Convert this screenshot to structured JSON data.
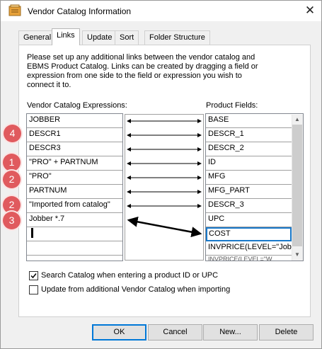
{
  "window": {
    "title": "Vendor Catalog Information",
    "close_label": "✕"
  },
  "tabs": [
    {
      "label": "General"
    },
    {
      "label": "Links"
    },
    {
      "label": "Update"
    },
    {
      "label": "Sort"
    },
    {
      "label": "Folder Structure"
    }
  ],
  "active_tab": "Links",
  "links": {
    "description": "Please set up any additional links between the vendor catalog and EBMS Product Catalog. Links can be created by dragging a field or expression from one side to the field or expression you wish to connect it to.",
    "left_header": "Vendor Catalog Expressions:",
    "right_header": "Product Fields:",
    "vendor_expressions": [
      "JOBBER",
      "DESCR1",
      "DESCR3",
      "\"PRO\" + PARTNUM",
      "\"PRO\"",
      "PARTNUM",
      "\"Imported from catalog\"",
      "Jobber *.7",
      "",
      "",
      ""
    ],
    "product_fields": [
      "BASE",
      "DESCR_1",
      "DESCR_2",
      "ID",
      "MFG",
      "MFG_PART",
      "DESCR_3",
      "UPC",
      "COST",
      "INVPRICE(LEVEL=\"Job",
      "INVPRICE(LEVEL=\"W"
    ],
    "selected_product_field": "COST"
  },
  "annotations": [
    "4",
    "1",
    "2",
    "2",
    "3"
  ],
  "options": {
    "search_catalog": {
      "label": "Search Catalog when entering a product ID or UPC",
      "checked": true
    },
    "update_additional": {
      "label": "Update from additional Vendor Catalog when importing",
      "checked": false
    }
  },
  "buttons": {
    "ok": "OK",
    "cancel": "Cancel",
    "new": "New...",
    "delete": "Delete"
  },
  "colors": {
    "accent": "#0078d7",
    "badge": "#e05a5e",
    "selection": "#1979ca"
  }
}
